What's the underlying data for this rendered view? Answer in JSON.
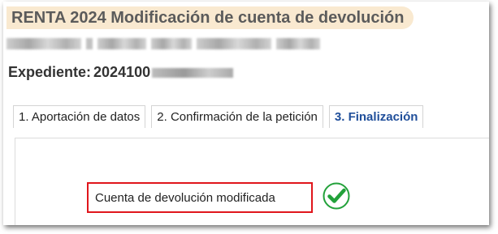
{
  "header": {
    "title": "RENTA 2024 Modificación de cuenta de devolución"
  },
  "expediente": {
    "label": "Expediente:",
    "number": "2024100"
  },
  "tabs": [
    {
      "label": "1. Aportación de datos",
      "active": false
    },
    {
      "label": "2. Confirmación de la petición",
      "active": false
    },
    {
      "label": "3. Finalización",
      "active": true
    }
  ],
  "result": {
    "message": "Cuenta de devolución modificada",
    "status_icon": "check-circle-icon",
    "highlight_color": "#e0161c",
    "check_color": "#22a13a"
  },
  "colors": {
    "title_background": "#f9e9d0",
    "active_tab_text": "#1f4e9a"
  }
}
